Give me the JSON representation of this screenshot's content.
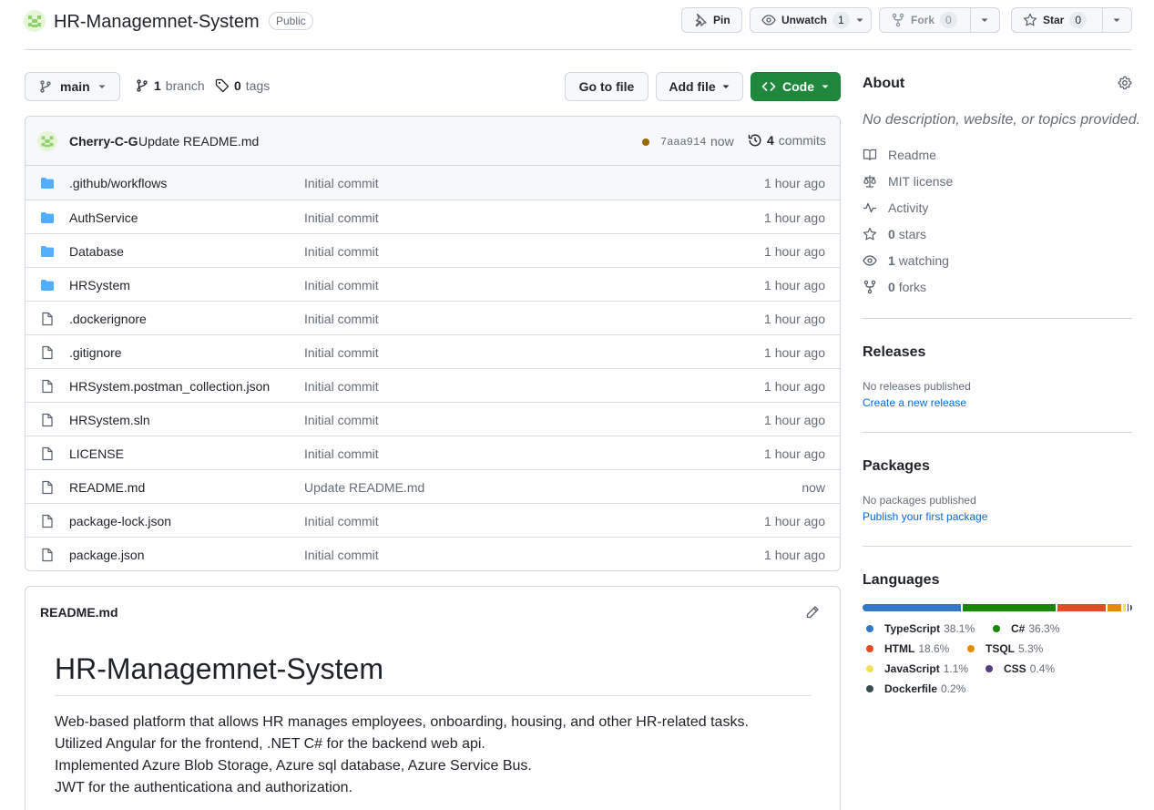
{
  "repo": {
    "name": "HR-Managemnet-System",
    "visibility": "Public"
  },
  "header_buttons": {
    "pin": "Pin",
    "unwatch": "Unwatch",
    "watch_count": "1",
    "fork": "Fork",
    "fork_count": "0",
    "star": "Star",
    "star_count": "0"
  },
  "toolbar": {
    "branch": "main",
    "branch_count": "1",
    "branch_label": "branch",
    "tag_count": "0",
    "tag_label": "tags",
    "go_to_file": "Go to file",
    "add_file": "Add file",
    "code": "Code"
  },
  "latest_commit": {
    "author": "Cherry-C-G",
    "message": "Update README.md",
    "sha": "7aaa914",
    "time": "now",
    "commit_count": "4",
    "commits_label": "commits",
    "status_color": "#9a6700"
  },
  "files": [
    {
      "name": ".github/workflows",
      "type": "folder",
      "commit": "Initial commit",
      "age": "1 hour ago"
    },
    {
      "name": "AuthService",
      "type": "folder",
      "commit": "Initial commit",
      "age": "1 hour ago"
    },
    {
      "name": "Database",
      "type": "folder",
      "commit": "Initial commit",
      "age": "1 hour ago"
    },
    {
      "name": "HRSystem",
      "type": "folder",
      "commit": "Initial commit",
      "age": "1 hour ago"
    },
    {
      "name": ".dockerignore",
      "type": "file",
      "commit": "Initial commit",
      "age": "1 hour ago"
    },
    {
      "name": ".gitignore",
      "type": "file",
      "commit": "Initial commit",
      "age": "1 hour ago"
    },
    {
      "name": "HRSystem.postman_collection.json",
      "type": "file",
      "commit": "Initial commit",
      "age": "1 hour ago"
    },
    {
      "name": "HRSystem.sln",
      "type": "file",
      "commit": "Initial commit",
      "age": "1 hour ago"
    },
    {
      "name": "LICENSE",
      "type": "file",
      "commit": "Initial commit",
      "age": "1 hour ago"
    },
    {
      "name": "README.md",
      "type": "file",
      "commit": "Update README.md",
      "age": "now"
    },
    {
      "name": "package-lock.json",
      "type": "file",
      "commit": "Initial commit",
      "age": "1 hour ago"
    },
    {
      "name": "package.json",
      "type": "file",
      "commit": "Initial commit",
      "age": "1 hour ago"
    }
  ],
  "readme": {
    "filename": "README.md",
    "title": "HR-Managemnet-System",
    "lines": [
      "Web-based platform that allows HR manages employees, onboarding, housing, and other HR-related tasks.",
      "Utilized Angular for the frontend, .NET C# for the backend web api.",
      "Implemented Azure Blob Storage, Azure sql database, Azure Service Bus.",
      "JWT for the authenticationa and authorization."
    ]
  },
  "about": {
    "heading": "About",
    "description": "No description, website, or topics provided.",
    "readme": "Readme",
    "license": "MIT license",
    "activity": "Activity",
    "stars_count": "0",
    "stars_label": "stars",
    "watching_count": "1",
    "watching_label": "watching",
    "forks_count": "0",
    "forks_label": "forks"
  },
  "releases": {
    "heading": "Releases",
    "empty": "No releases published",
    "link": "Create a new release"
  },
  "packages": {
    "heading": "Packages",
    "empty": "No packages published",
    "link": "Publish your first package"
  },
  "languages": {
    "heading": "Languages",
    "items": [
      {
        "name": "TypeScript",
        "percent": "38.1%",
        "value": 38.1,
        "color": "#3178c6"
      },
      {
        "name": "C#",
        "percent": "36.3%",
        "value": 36.3,
        "color": "#178600"
      },
      {
        "name": "HTML",
        "percent": "18.6%",
        "value": 18.6,
        "color": "#e34c26"
      },
      {
        "name": "TSQL",
        "percent": "5.3%",
        "value": 5.3,
        "color": "#e38c00"
      },
      {
        "name": "JavaScript",
        "percent": "1.1%",
        "value": 1.1,
        "color": "#f1e05a"
      },
      {
        "name": "CSS",
        "percent": "0.4%",
        "value": 0.4,
        "color": "#563d7c"
      },
      {
        "name": "Dockerfile",
        "percent": "0.2%",
        "value": 0.2,
        "color": "#384d54"
      }
    ]
  },
  "colors": {
    "accent_green": "#1f883d",
    "link_blue": "#0969da",
    "folder_blue": "#54aeff",
    "muted": "#656d76"
  }
}
